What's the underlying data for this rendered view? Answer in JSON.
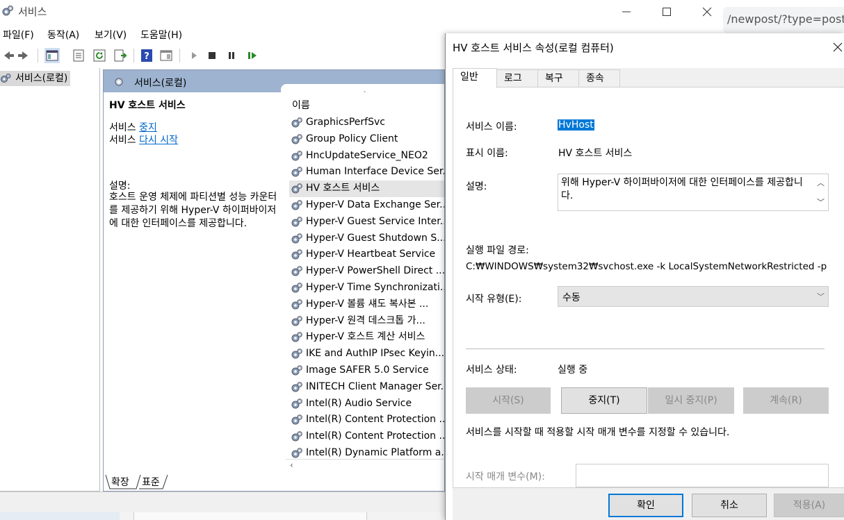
{
  "window": {
    "title": "서비스"
  },
  "menu": {
    "file": "파일(F)",
    "action": "동작(A)",
    "view": "보기(V)",
    "help": "도움말(H)"
  },
  "tree": {
    "root": "서비스(로컬)"
  },
  "content": {
    "header": "서비스(로컬)",
    "selected_name": "HV 호스트 서비스",
    "stop_prefix": "서비스 ",
    "stop_link": "중지",
    "restart_prefix": "서비스 ",
    "restart_link": "다시 시작",
    "desc_label": "설명:",
    "desc_text": "호스트 운영 체제에 파티션별 성능 카운터를 제공하기 위해 Hyper-V 하이퍼바이저에 대한 인터페이스를 제공합니다.",
    "column_name": "이름",
    "sort_arrow": "ˆ",
    "scroll_left": "‹",
    "services": [
      "GraphicsPerfSvc",
      "Group Policy Client",
      "HncUpdateService_NEO2",
      "Human Interface Device Ser...",
      "HV 호스트 서비스",
      "Hyper-V Data Exchange Ser...",
      "Hyper-V Guest Service Inter...",
      "Hyper-V Guest Shutdown S...",
      "Hyper-V Heartbeat Service",
      "Hyper-V PowerShell Direct ...",
      "Hyper-V Time Synchronizati...",
      "Hyper-V 볼륨 섀도 복사본 ...",
      "Hyper-V 원격 데스크톱 가...",
      "Hyper-V 호스트 계산 서비스",
      "IKE and AuthIP IPsec Keyin...",
      "Image SAFER 5.0 Service",
      "INITECH Client Manager Ser...",
      "Intel(R) Audio Service",
      "Intel(R) Content Protection ...",
      "Intel(R) Content Protection ...",
      "Intel(R) Dynamic Platform a..."
    ],
    "selected_index": 4,
    "tab_extended": "확장",
    "tab_standard": "표준"
  },
  "browser": {
    "url_fragment": "/newpost/?type=post"
  },
  "dialog": {
    "title": "HV 호스트 서비스 속성(로컬 컴퓨터)",
    "tabs": [
      "일반",
      "로그온",
      "복구",
      "종속성"
    ],
    "active_tab": 0,
    "service_name_label": "서비스 이름:",
    "service_name_value": "HvHost",
    "display_name_label": "표시 이름:",
    "display_name_value": "HV 호스트 서비스",
    "description_label": "설명:",
    "description_value": "위해 Hyper-V 하이퍼바이저에 대한 인터페이스를 제공합니다.",
    "exe_path_label": "실행 파일 경로:",
    "exe_path_value": "C:₩WINDOWS₩system32₩svchost.exe -k LocalSystemNetworkRestricted -p",
    "startup_type_label": "시작 유형(E):",
    "startup_type_value": "수동",
    "status_label": "서비스 상태:",
    "status_value": "실행 중",
    "buttons": {
      "start": "시작(S)",
      "stop": "중지(T)",
      "pause": "일시 중지(P)",
      "resume": "계속(R)"
    },
    "params_hint": "서비스를 시작할 때 적용할 시작 매개 변수를 지정할 수 있습니다.",
    "params_label": "시작 매개 변수(M):",
    "footer": {
      "ok": "확인",
      "cancel": "취소",
      "apply": "적용(A)"
    },
    "accent_color": "#0078d7"
  }
}
